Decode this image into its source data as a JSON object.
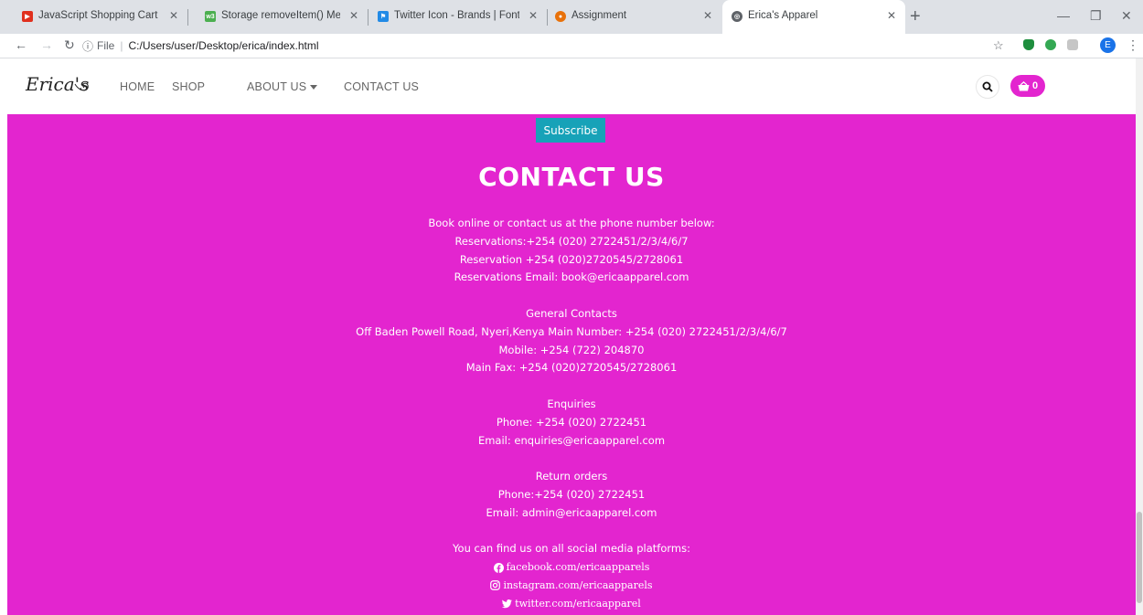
{
  "browser": {
    "tabs": [
      {
        "title": "JavaScript Shopping Cart Tutorial",
        "favicon_color": "#e0301e",
        "favicon": "youtube-icon"
      },
      {
        "title": "Storage removeItem() Method",
        "favicon_color": "#4caf50",
        "favicon": "w3schools-icon"
      },
      {
        "title": "Twitter Icon - Brands | Font Awesome",
        "favicon_color": "#228ae6",
        "favicon": "fontawesome-icon"
      },
      {
        "title": "Assignment",
        "favicon_color": "#e8710a",
        "favicon": "moodle-icon"
      },
      {
        "title": "Erica's Apparel",
        "favicon_color": "#5f6368",
        "favicon": "globe-icon"
      }
    ],
    "address": {
      "label": "File",
      "url": "C:/Users/user/Desktop/erica/index.html"
    },
    "profile_initial": "E"
  },
  "nav": {
    "logo_text": "Erica's",
    "links": [
      "HOME",
      "SHOP",
      "ABOUT US",
      "CONTACT US"
    ],
    "cart_count": "0",
    "accent_color": "#e325cf"
  },
  "subscribe_label": "Subscribe",
  "contact": {
    "title": "CONTACT US",
    "booking": [
      "Book online or contact us at the phone number below:",
      "Reservations:+254 (020) 2722451/2/3/4/6/7",
      "Reservation +254 (020)2720545/2728061",
      "Reservations Email: book@ericaapparel.com"
    ],
    "general": [
      "General Contacts",
      "Off Baden Powell Road, Nyeri,Kenya Main Number: +254 (020) 2722451/2/3/4/6/7",
      "Mobile: +254 (722) 204870",
      "Main Fax: +254 (020)2720545/2728061"
    ],
    "enquiries": [
      "Enquiries",
      "Phone: +254 (020) 2722451",
      "Email: enquiries@ericaapparel.com"
    ],
    "returns": [
      "Return orders",
      "Phone:+254 (020) 2722451",
      "Email: admin@ericaapparel.com"
    ],
    "social_intro": "You can find us on all social media platforms:",
    "social": {
      "facebook": "facebook.com/ericaapparels",
      "instagram": "instagram.com/ericaapparels",
      "twitter": "twitter.com/ericaapparel"
    }
  }
}
